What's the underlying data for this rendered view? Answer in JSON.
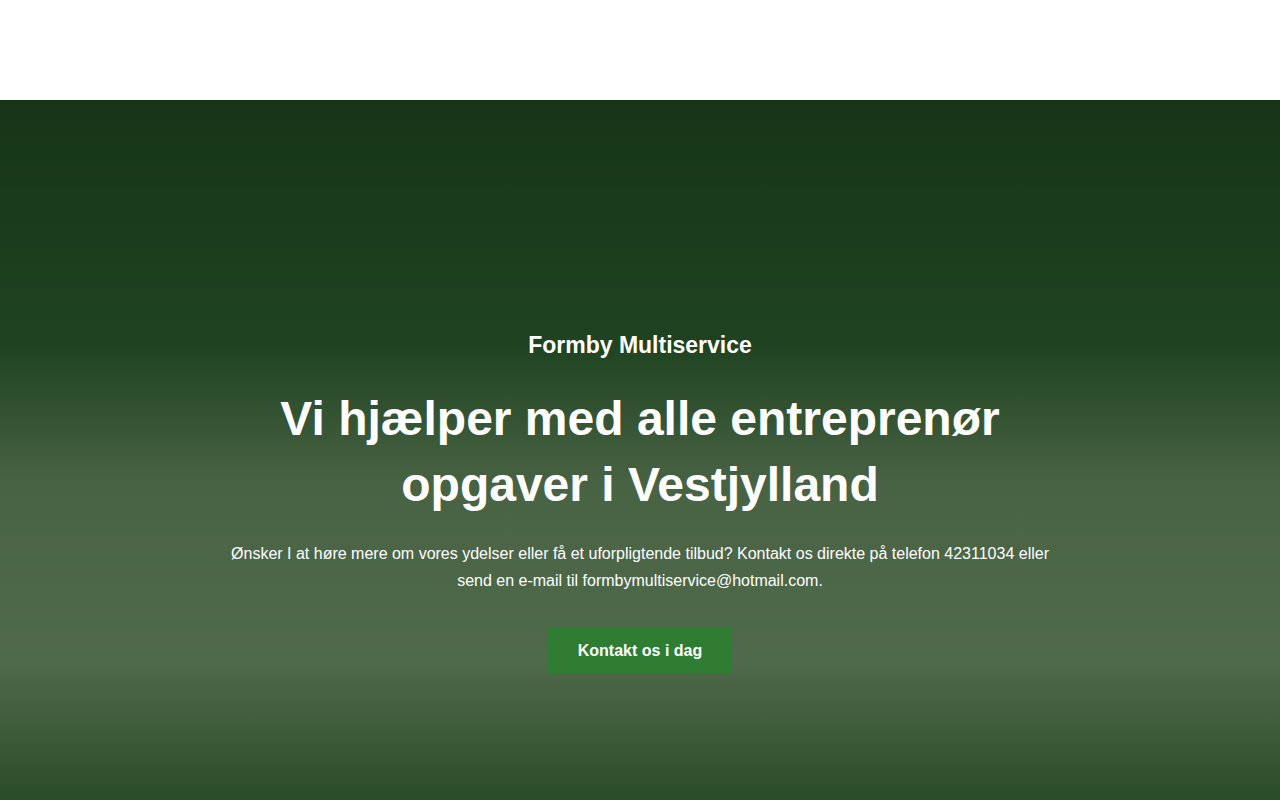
{
  "header": {},
  "hero": {
    "eyebrow": "Formby Multiservice",
    "title": "Vi hjælper med alle entreprenør opgaver i Vestjylland",
    "description": "Ønsker I at høre mere om vores ydelser eller få et uforpligtende tilbud? Kontakt os direkte på telefon 42311034 eller send en e-mail til formbymultiservice@hotmail.com.",
    "button": "Kontakt os i dag"
  }
}
